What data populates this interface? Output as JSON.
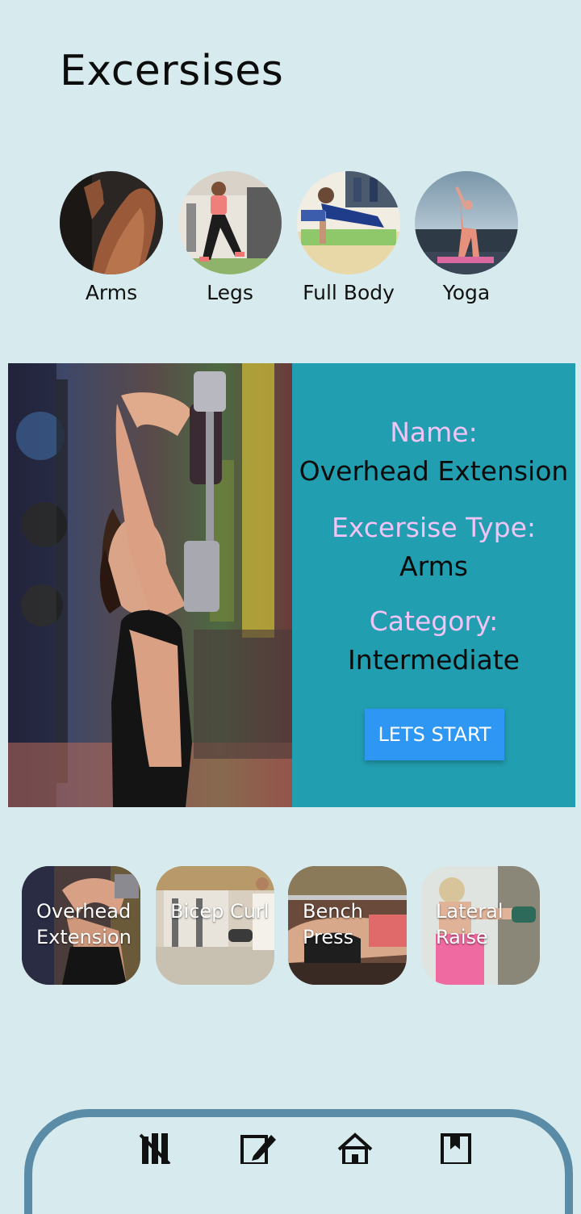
{
  "header": {
    "title": "Excersises"
  },
  "categories": [
    {
      "label": "Arms",
      "image": "arms-photo"
    },
    {
      "label": "Legs",
      "image": "legs-photo"
    },
    {
      "label": "Full Body",
      "image": "full-body-photo"
    },
    {
      "label": "Yoga",
      "image": "yoga-photo"
    }
  ],
  "featured": {
    "image": "overhead-extension-photo",
    "name_key": "Name:",
    "name_value": "Overhead Extension",
    "type_key": "Excersise Type:",
    "type_value": "Arms",
    "category_key": "Category:",
    "category_value": "Intermediate",
    "start_label": "LETS START"
  },
  "exercises": [
    {
      "label": "Overhead\nExtension",
      "image": "overhead-extension-photo"
    },
    {
      "label": "Bicep Curl",
      "image": "bicep-curl-photo"
    },
    {
      "label": "Bench\nPress",
      "image": "bench-press-photo"
    },
    {
      "label": "Lateral\nRaise",
      "image": "lateral-raise-photo"
    }
  ],
  "bottom_nav": [
    {
      "icon": "fitness-icon"
    },
    {
      "icon": "edit-icon"
    },
    {
      "icon": "home-icon"
    },
    {
      "icon": "bookmark-icon"
    }
  ],
  "colors": {
    "background": "#d7ebee",
    "info_panel": "#219eb0",
    "info_key": "#f0c4f6",
    "button": "#2e97f3",
    "nav_border": "#5a8ca8"
  }
}
